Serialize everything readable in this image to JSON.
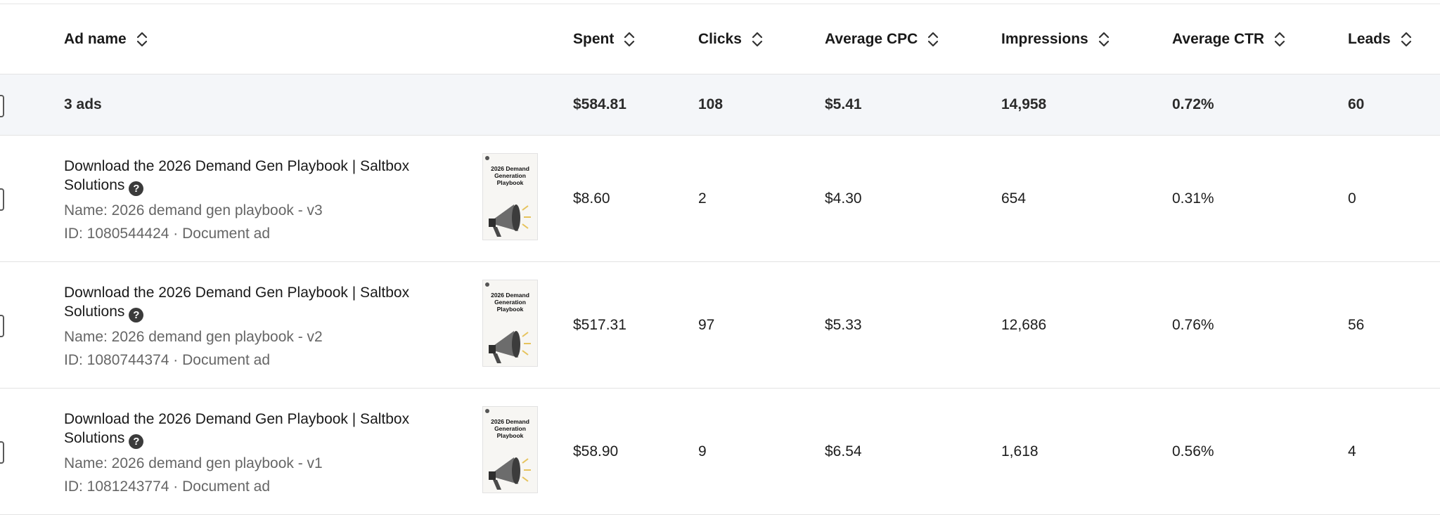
{
  "columns": {
    "ad_name": "Ad name",
    "spent": "Spent",
    "clicks": "Clicks",
    "avg_cpc": "Average CPC",
    "impressions": "Impressions",
    "avg_ctr": "Average CTR",
    "leads": "Leads"
  },
  "icons": {
    "sort": "sort-updown-icon",
    "help": "help-circle-icon",
    "thumbnail": "megaphone-icon"
  },
  "summary": {
    "label": "3 ads",
    "spent": "$584.81",
    "clicks": "108",
    "avg_cpc": "$5.41",
    "impressions": "14,958",
    "avg_ctr": "0.72%",
    "leads": "60"
  },
  "ads": [
    {
      "title": "Download the 2026 Demand Gen Playbook | Saltbox Solutions",
      "name": "Name: 2026 demand gen playbook - v3",
      "id": "ID: 1080544424 · Document ad",
      "thumb_title": "2026 Demand Generation Playbook",
      "spent": "$8.60",
      "clicks": "2",
      "avg_cpc": "$4.30",
      "impressions": "654",
      "avg_ctr": "0.31%",
      "leads": "0"
    },
    {
      "title": "Download the 2026 Demand Gen Playbook | Saltbox Solutions",
      "name": "Name: 2026 demand gen playbook - v2",
      "id": "ID: 1080744374 · Document ad",
      "thumb_title": "2026 Demand Generation Playbook",
      "spent": "$517.31",
      "clicks": "97",
      "avg_cpc": "$5.33",
      "impressions": "12,686",
      "avg_ctr": "0.76%",
      "leads": "56"
    },
    {
      "title": "Download the 2026 Demand Gen Playbook | Saltbox Solutions",
      "name": "Name: 2026 demand gen playbook - v1",
      "id": "ID: 1081243774 · Document ad",
      "thumb_title": "2026 Demand Generation Playbook",
      "spent": "$58.90",
      "clicks": "9",
      "avg_cpc": "$6.54",
      "impressions": "1,618",
      "avg_ctr": "0.56%",
      "leads": "4"
    }
  ]
}
